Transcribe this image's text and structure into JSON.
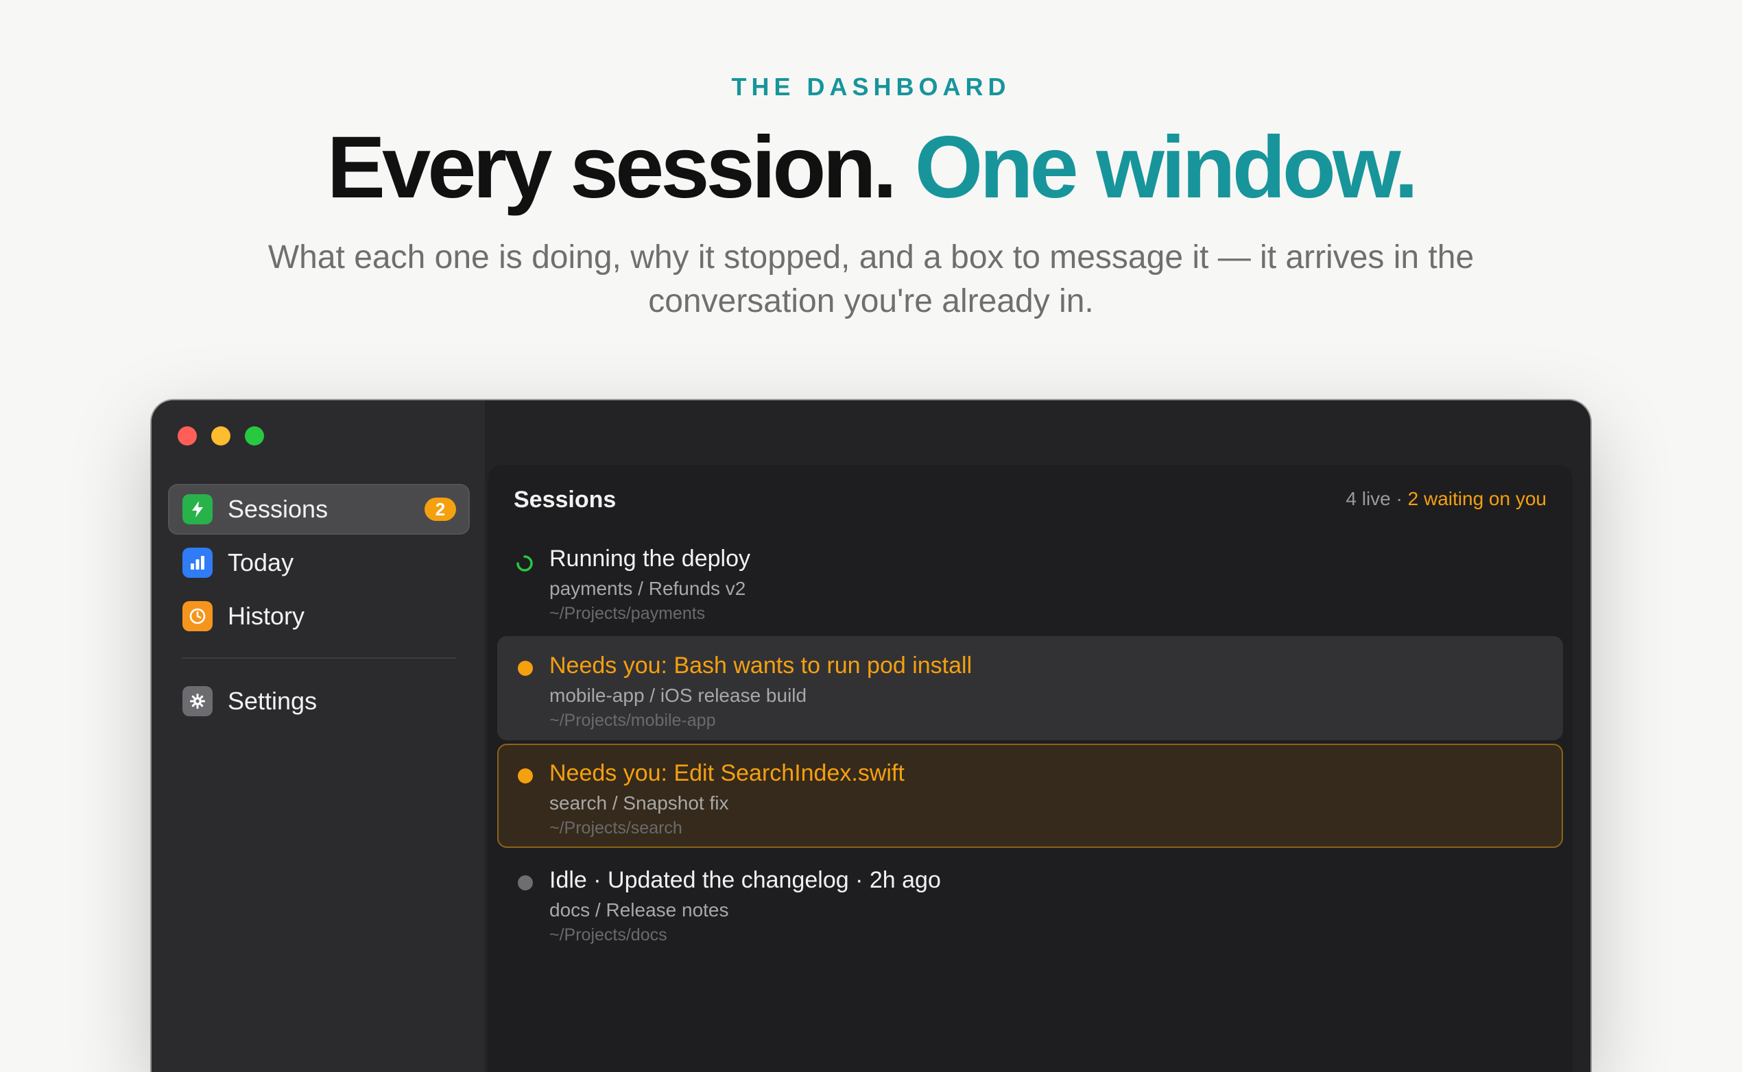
{
  "hero": {
    "eyebrow": "THE DASHBOARD",
    "headline_main": "Every session.",
    "headline_accent": "One window.",
    "subhead": "What each one is doing, why it stopped, and a box to message it — it arrives in the conversation you're already in."
  },
  "colors": {
    "accent": "#17959b",
    "warning": "#f5a00f",
    "running": "#28c840"
  },
  "sidebar": {
    "items": [
      {
        "label": "Sessions",
        "icon": "bolt-icon",
        "badge": "2",
        "active": true
      },
      {
        "label": "Today",
        "icon": "bar-chart-icon"
      },
      {
        "label": "History",
        "icon": "clock-icon"
      },
      {
        "label": "Settings",
        "icon": "gear-icon"
      }
    ]
  },
  "main": {
    "title": "Sessions",
    "live_count": "4 live",
    "separator": " · ",
    "waiting": "2 waiting on you",
    "sessions": [
      {
        "title": "Running the deploy",
        "subtitle": "payments / Refunds v2",
        "path": "~/Projects/payments",
        "status": "running"
      },
      {
        "title": "Needs you: Bash wants to run pod install",
        "subtitle": "mobile-app / iOS release build",
        "path": "~/Projects/mobile-app",
        "status": "waiting"
      },
      {
        "title": "Needs you: Edit SearchIndex.swift",
        "subtitle": "search / Snapshot fix",
        "path": "~/Projects/search",
        "status": "waiting"
      },
      {
        "title": "Idle · Updated the changelog · 2h ago",
        "subtitle": "docs / Release notes",
        "path": "~/Projects/docs",
        "status": "idle"
      }
    ]
  }
}
